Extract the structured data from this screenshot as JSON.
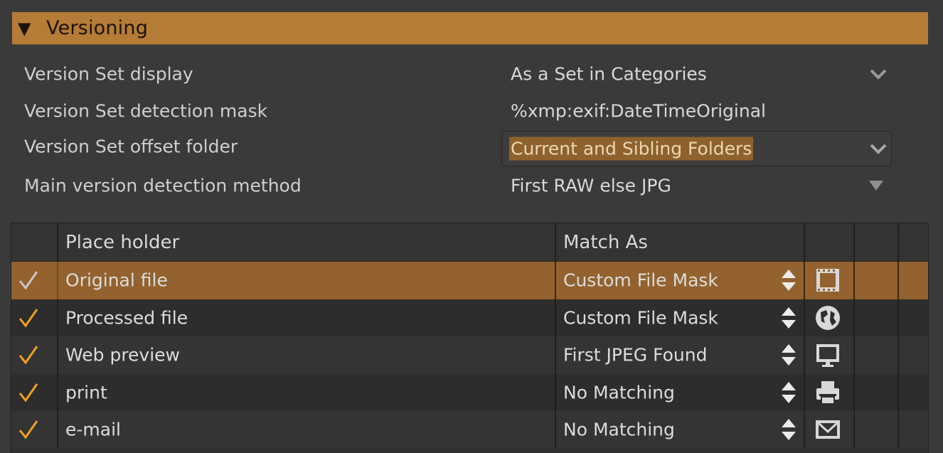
{
  "section": {
    "title": "Versioning",
    "expanded_icon": "triangle-down-icon"
  },
  "properties": [
    {
      "label": "Version Set display",
      "value": "As a Set in Categories",
      "control": "chevron"
    },
    {
      "label": "Version Set detection mask",
      "value": "%xmp:exif:DateTimeOriginal",
      "control": "text"
    },
    {
      "label": "Version Set offset folder",
      "value": "Current and Sibling Folders",
      "control": "combo-focused"
    },
    {
      "label": "Main version detection method",
      "value": "First RAW else JPG",
      "control": "triangle"
    }
  ],
  "table": {
    "columns": [
      "",
      "Place holder",
      "Match As",
      "",
      "",
      ""
    ],
    "rows": [
      {
        "checked": true,
        "placeholder": "Original file",
        "match_as": "Custom File Mask",
        "icon": "film-icon",
        "selected": true
      },
      {
        "checked": true,
        "placeholder": "Processed file",
        "match_as": "Custom File Mask",
        "icon": "globe-icon",
        "selected": false
      },
      {
        "checked": true,
        "placeholder": "Web preview",
        "match_as": "First JPEG Found",
        "icon": "monitor-icon",
        "selected": false
      },
      {
        "checked": true,
        "placeholder": "print",
        "match_as": "No Matching",
        "icon": "printer-icon",
        "selected": false
      },
      {
        "checked": true,
        "placeholder": "e-mail",
        "match_as": "No Matching",
        "icon": "envelope-icon",
        "selected": false
      }
    ]
  },
  "colors": {
    "header_bg": "#b47c37",
    "selection": "#93622e",
    "check_active": "#f0a020",
    "check_selected": "#c8c8c8",
    "background": "#3a3a3a"
  }
}
